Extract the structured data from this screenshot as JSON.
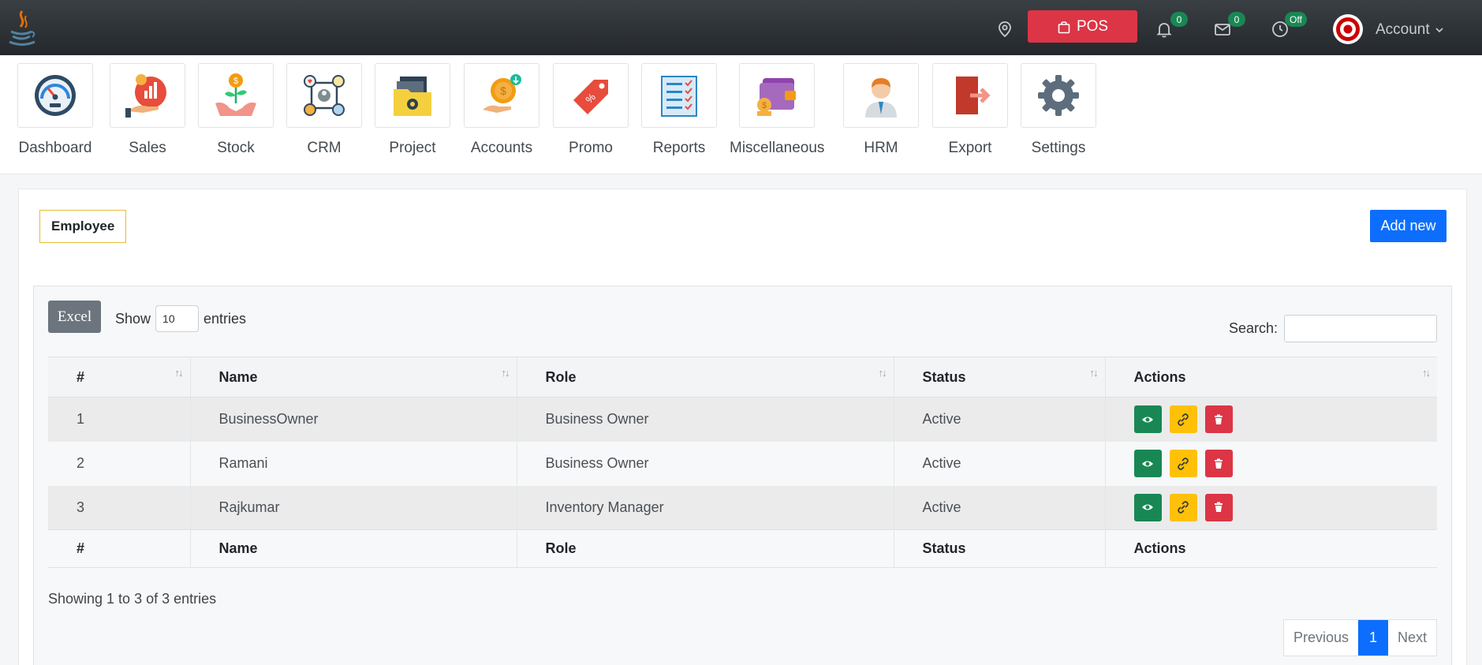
{
  "header": {
    "pos_label": "POS",
    "notifications_badge": "0",
    "messages_badge": "0",
    "clock_badge": "Off",
    "account_label": "Account"
  },
  "modules": [
    {
      "label": "Dashboard",
      "icon": "dashboard-gauge-icon"
    },
    {
      "label": "Sales",
      "icon": "sales-chart-hand-icon"
    },
    {
      "label": "Stock",
      "icon": "stock-plant-icon"
    },
    {
      "label": "CRM",
      "icon": "crm-network-icon"
    },
    {
      "label": "Project",
      "icon": "project-folder-gear-icon"
    },
    {
      "label": "Accounts",
      "icon": "accounts-coin-hand-icon"
    },
    {
      "label": "Promo",
      "icon": "promo-tag-icon"
    },
    {
      "label": "Reports",
      "icon": "reports-checklist-icon"
    },
    {
      "label": "Miscellaneous",
      "icon": "wallet-icon"
    },
    {
      "label": "HRM",
      "icon": "employee-person-icon"
    },
    {
      "label": "Export",
      "icon": "export-door-icon"
    },
    {
      "label": "Settings",
      "icon": "settings-gear-icon"
    }
  ],
  "page": {
    "section_label": "Employee",
    "add_new_label": "Add new"
  },
  "table_controls": {
    "excel_label": "Excel",
    "show_label": "Show",
    "entries_value": "10",
    "entries_label": "entries",
    "search_label": "Search:"
  },
  "table": {
    "columns": [
      "#",
      "Name",
      "Role",
      "Status",
      "Actions"
    ],
    "rows": [
      {
        "num": "1",
        "name": "BusinessOwner",
        "role": "Business Owner",
        "status": "Active"
      },
      {
        "num": "2",
        "name": "Ramani",
        "role": "Business Owner",
        "status": "Active"
      },
      {
        "num": "3",
        "name": "Rajkumar",
        "role": "Inventory Manager",
        "status": "Active"
      }
    ]
  },
  "footer": {
    "info": "Showing 1 to 3 of 3 entries",
    "prev_label": "Previous",
    "page": "1",
    "next_label": "Next"
  },
  "colors": {
    "pos": "#dc3545",
    "primary": "#0d6efd",
    "success": "#198754",
    "warning": "#ffc107",
    "danger": "#dc3545"
  }
}
